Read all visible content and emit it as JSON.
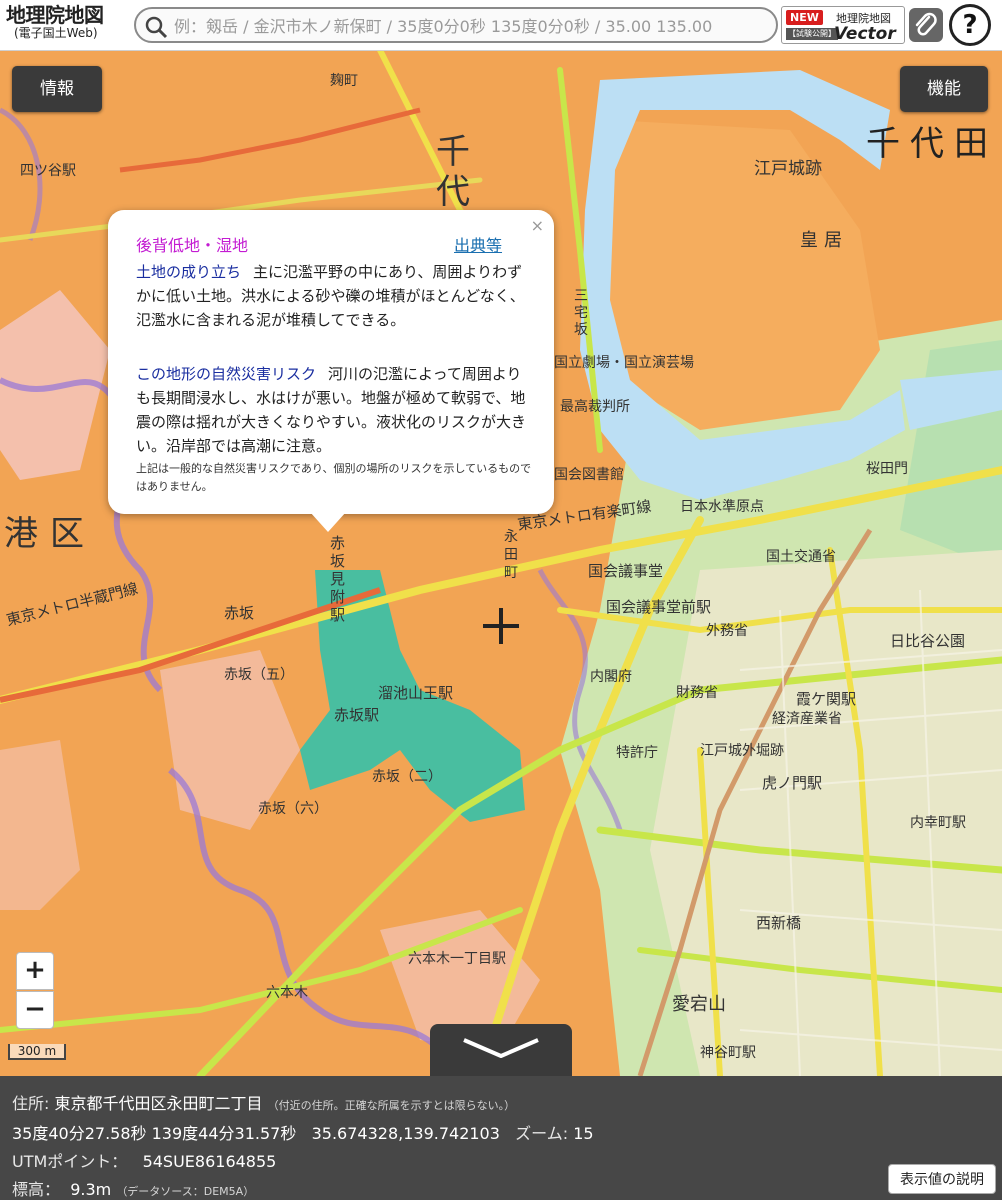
{
  "header": {
    "logo_title": "地理院地図",
    "logo_subtitle": "(電子国土Web)",
    "search_placeholder": "例：剱岳 / 金沢市木ノ新保町 / 35度0分0秒 135度0分0秒 / 35.00 135.00",
    "vector_new": "NEW",
    "vector_trial": "【試験公開】",
    "vector_name": "地理院地図",
    "vector_word": "Vector",
    "help_label": "?"
  },
  "controls": {
    "info_label": "情報",
    "function_label": "機能",
    "zoom_in": "+",
    "zoom_out": "−",
    "scale": "300 m"
  },
  "popup": {
    "close": "×",
    "title": "後背低地・湿地",
    "source_link": "出典等",
    "sections": [
      {
        "heading": "土地の成り立ち",
        "text": "主に氾濫平野の中にあり、周囲よりわずかに低い土地。洪水による砂や礫の堆積がほとんどなく、氾濫水に含まれる泥が堆積してできる。"
      },
      {
        "heading": "この地形の自然災害リスク",
        "text": "河川の氾濫によって周囲よりも長期間浸水し、水はけが悪い。地盤が極めて軟弱で、地震の際は揺れが大きくなりやすい。液状化のリスクが大きい。沿岸部では高潮に注意。"
      }
    ],
    "note": "上記は一般的な自然災害リスクであり、個別の場所のリスクを示しているものではありません。"
  },
  "map_labels": {
    "chiyoda_city": "千代田",
    "chiyoda_big": "千代",
    "minato": "港区",
    "imperial_palace": "皇居",
    "edo_castle": "江戸城跡",
    "kokai": "国会議事堂",
    "kokai_station": "国会議事堂前駅",
    "akasaka_station": "赤坂駅",
    "akasaka_mitsuke": "赤坂見附駅",
    "tameike_sanno": "溜池山王駅",
    "toranomon": "虎ノ門駅",
    "kasumigaseki": "霞ケ関駅",
    "hibiya_park": "日比谷公園",
    "atago": "愛宕山",
    "roppongi": "六本木",
    "akasaka": "赤坂",
    "nagata": "永田町",
    "sakuradamon": "桜田門",
    "hanzomon_line": "東京メトロ半蔵門線",
    "yurakucho_line": "東京メトロ有楽町線",
    "kokuritsu_gekijo": "国立劇場・国立演芸場",
    "saiko_saibansho": "最高裁判所",
    "kokkai_toshokan": "国会図書館",
    "suijun": "日本水準原点",
    "miyakezaka": "三宅坂",
    "kokudo": "国土交通省",
    "gaimusho": "外務省",
    "zaimusho": "財務省",
    "keisansho": "経済産業省",
    "tokkyo": "特許庁",
    "edo_soto": "江戸城外堀跡",
    "naikaku": "内閣府",
    "nishishinbashi": "西新橋",
    "kamiyacho": "神谷町駅",
    "kojimachi": "麹町",
    "yotsuya": "四ツ谷駅",
    "akasaka_go": "赤坂（五）",
    "akasaka_ni": "赤坂（二）",
    "akasaka_roku": "赤坂（六）",
    "roppongi_ichi": "六本木一丁目駅",
    "uchisaiwaicho": "内幸町駅"
  },
  "panel": {
    "address_label": "住所:",
    "address": "東京都千代田区永田町二丁目",
    "address_note": "（付近の住所。正確な所属を示すとは限らない。）",
    "dms": "35度40分27.58秒 139度44分31.57秒",
    "decimal": "35.674328,139.742103",
    "zoom_label": "ズーム:",
    "zoom": "15",
    "utm_label": "UTMポイント：",
    "utm": "54SUE86164855",
    "elev_label": "標高：",
    "elev": "9.3m",
    "elev_source": "（データソース：DEM5A）",
    "explain_button": "表示値の説明"
  }
}
